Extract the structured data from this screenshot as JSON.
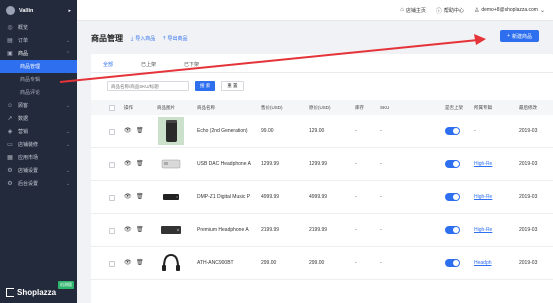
{
  "sidebar": {
    "brand": "Vallin",
    "brand_caret": "▸",
    "items": [
      {
        "label": "概览",
        "icon": "dashboard-icon"
      },
      {
        "label": "订单",
        "icon": "order-icon"
      },
      {
        "label": "商品",
        "icon": "product-icon"
      },
      {
        "label": "顾客",
        "icon": "customer-icon"
      },
      {
        "label": "数据",
        "icon": "chart-icon"
      },
      {
        "label": "营销",
        "icon": "marketing-icon"
      },
      {
        "label": "店铺装修",
        "icon": "store-design-icon"
      },
      {
        "label": "应用市场",
        "icon": "app-market-icon"
      },
      {
        "label": "店铺设置",
        "icon": "store-settings-icon"
      },
      {
        "label": "后台设置",
        "icon": "admin-settings-icon"
      }
    ],
    "product_sub": [
      "商品管理",
      "商品专辑",
      "商品评论"
    ],
    "footer_logo": "Shoplazza",
    "footer_badge": "机测版"
  },
  "topbar": {
    "store_home": "店铺主页",
    "help": "帮助中心",
    "user": "demo+8@shoplazza.com"
  },
  "page": {
    "title": "商品管理",
    "import": "导入商品",
    "export": "导出商品",
    "new_button": "新建商品"
  },
  "tabs": [
    "全部",
    "已上架",
    "已下架"
  ],
  "search": {
    "placeholder": "商品名称/商品SKU/标题",
    "search_btn": "搜 索",
    "reset_btn": "重 置"
  },
  "columns": [
    "操作",
    "商品图片",
    "商品名称",
    "售价(USD)",
    "原价(USD)",
    "库存",
    "SKU",
    "是否上架",
    "所属专辑",
    "最后修改"
  ],
  "rows": [
    {
      "name": "Echo (2nd Generation)",
      "price": "99.00",
      "orig": "129.00",
      "stock": "-",
      "sku": "-",
      "album": "-",
      "updated": "2019-03",
      "thumb": "speaker"
    },
    {
      "name": "USB DAC Headphone A",
      "price": "1299.99",
      "orig": "1299.99",
      "stock": "-",
      "sku": "-",
      "album": "High-Re",
      "updated": "2019-03",
      "thumb": "dac"
    },
    {
      "name": "DMP-Z1 Digital Music P",
      "price": "4999.99",
      "orig": "4999.99",
      "stock": "-",
      "sku": "-",
      "album": "High-Re",
      "updated": "2019-03",
      "thumb": "player"
    },
    {
      "name": "Premium Headphone A",
      "price": "2199.99",
      "orig": "2199.99",
      "stock": "-",
      "sku": "-",
      "album": "High-Re",
      "updated": "2019-03",
      "thumb": "amp"
    },
    {
      "name": "ATH-ANC900BT",
      "price": "299.00",
      "orig": "299.00",
      "stock": "-",
      "sku": "-",
      "album": "Headph",
      "updated": "2019-03",
      "thumb": "headphone"
    }
  ],
  "colors": {
    "accent": "#2e6ff0",
    "sidebar": "#232a3b",
    "annotation": "#e5333a"
  }
}
